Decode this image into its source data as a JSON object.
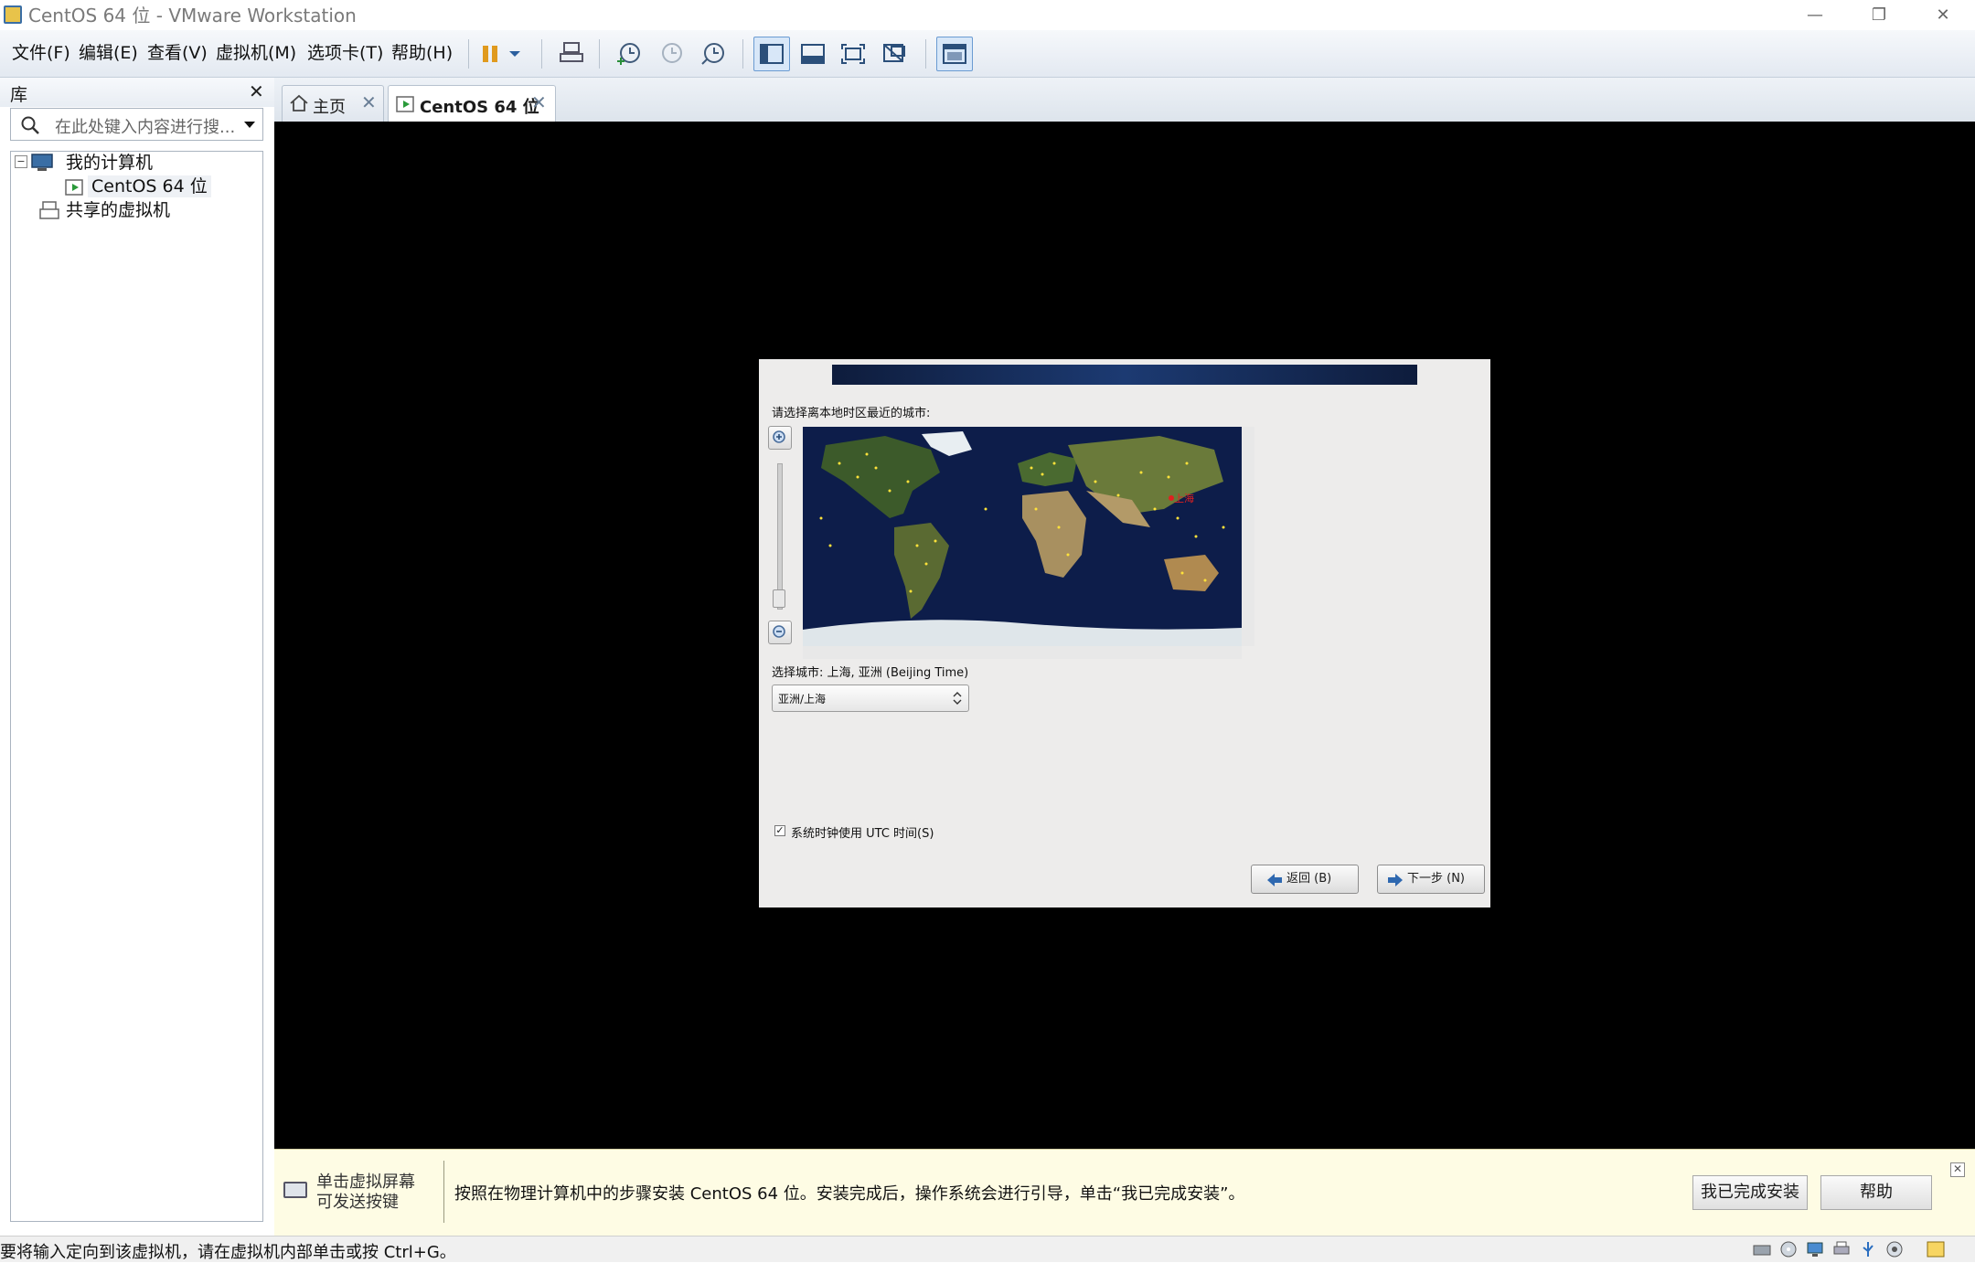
{
  "window": {
    "title": "CentOS 64 位 - VMware Workstation",
    "minimize": "—",
    "restore": "❐",
    "close": "✕"
  },
  "menu": [
    "文件(F)",
    "编辑(E)",
    "查看(V)",
    "虚拟机(M)",
    "选项卡(T)",
    "帮助(H)"
  ],
  "toolbar": {
    "icons": [
      "pause-icon",
      "dropdown-icon",
      "send-ctrl-alt-del-icon",
      "snapshot-take-icon",
      "snapshot-revert-icon",
      "snapshot-manager-icon",
      "show-library-icon",
      "show-thumbnail-icon",
      "fullscreen-icon",
      "unity-icon",
      "console-view-icon"
    ]
  },
  "library": {
    "title": "库",
    "close": "✕",
    "search_placeholder": "在此处键入内容进行搜...",
    "tree": {
      "my_computer": "我的计算机",
      "vm": "CentOS 64 位",
      "shared": "共享的虚拟机",
      "expander": "⊟"
    }
  },
  "tabs": [
    {
      "label": "主页",
      "close": "✕"
    },
    {
      "label": "CentOS 64 位",
      "close": "✕"
    }
  ],
  "installer": {
    "prompt": "请选择离本地时区最近的城市:",
    "selected_city_label": "选择城市: 上海, 亚洲 (Beijing Time)",
    "map_city_marker": "上海",
    "timezone_value": "亚洲/上海",
    "utc_label": "系统时钟使用 UTC 时间(S)",
    "utc_checked": "✓",
    "back_button": "返回 (B)",
    "next_button": "下一步 (N)"
  },
  "hint": {
    "left_text_line1": "单击虚拟屏幕",
    "left_text_line2": "可发送按键",
    "message": "按照在物理计算机中的步骤安装 CentOS 64 位。安装完成后，操作系统会进行引导，单击“我已完成安装”。",
    "done_button": "我已完成安装",
    "help_button": "帮助",
    "close": "✕"
  },
  "status": {
    "text": "要将输入定向到该虚拟机，请在虚拟机内部单击或按 Ctrl+G。"
  },
  "colors": {
    "accent": "#3a6ea5",
    "vm_background": "#000000",
    "hint_background": "#fefce4"
  }
}
